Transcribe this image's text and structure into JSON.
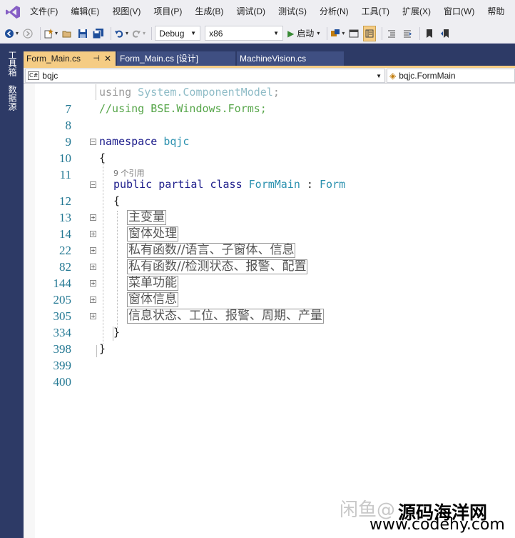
{
  "menu": {
    "items": [
      "文件(F)",
      "编辑(E)",
      "视图(V)",
      "项目(P)",
      "生成(B)",
      "调试(D)",
      "测试(S)",
      "分析(N)",
      "工具(T)",
      "扩展(X)",
      "窗口(W)",
      "帮助"
    ]
  },
  "toolbar": {
    "config": "Debug",
    "platform": "x86",
    "start_label": "启动"
  },
  "side_tabs": [
    "工具箱",
    "数据源"
  ],
  "doc_tabs": [
    {
      "label": "Form_Main.cs",
      "active": true
    },
    {
      "label": "Form_Main.cs [设计]",
      "active": false
    },
    {
      "label": "MachineVision.cs",
      "active": false
    }
  ],
  "nav": {
    "project": "bqjc",
    "class": "bqjc.FormMain"
  },
  "code": {
    "codelens": "9 个引用",
    "lines": [
      {
        "num": "7",
        "text": "using System.ComponentModel;"
      },
      {
        "num": "8",
        "text": "//using BSE.Windows.Forms;"
      },
      {
        "num": "9",
        "text": ""
      },
      {
        "num": "10",
        "text": "namespace bqjc"
      },
      {
        "num": "11",
        "text": "{"
      },
      {
        "num": "12",
        "text": "public partial class FormMain : Form"
      },
      {
        "num": "13",
        "text": "{"
      },
      {
        "num": "14",
        "text": "主变量"
      },
      {
        "num": "22",
        "text": "窗体处理"
      },
      {
        "num": "82",
        "text": "私有函数//语言、子窗体、信息"
      },
      {
        "num": "144",
        "text": "私有函数//检测状态、报警、配置"
      },
      {
        "num": "205",
        "text": "菜单功能"
      },
      {
        "num": "305",
        "text": "窗体信息"
      },
      {
        "num": "334",
        "text": "信息状态、工位、报警、周期、产量"
      },
      {
        "num": "398",
        "text": "}"
      },
      {
        "num": "399",
        "text": "}"
      },
      {
        "num": "400",
        "text": ""
      }
    ]
  },
  "watermark": {
    "faint": "闲鱼@",
    "site_name": "源码海洋网",
    "site_url": "www.codehy.com"
  }
}
